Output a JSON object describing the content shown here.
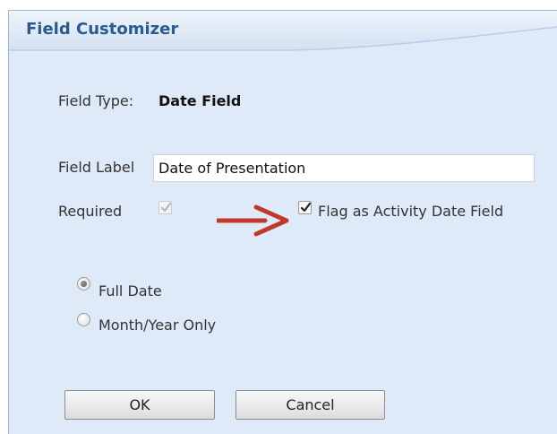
{
  "dialog": {
    "title": "Field Customizer"
  },
  "field_type": {
    "label": "Field Type:",
    "value": "Date Field"
  },
  "field_label": {
    "label": "Field Label",
    "value": "Date of Presentation"
  },
  "required": {
    "label": "Required",
    "checked": true,
    "disabled": true
  },
  "activity_flag": {
    "label": "Flag as Activity Date Field",
    "checked": true
  },
  "date_format": {
    "options": [
      {
        "label": "Full Date",
        "selected": true
      },
      {
        "label": "Month/Year Only",
        "selected": false
      }
    ]
  },
  "buttons": {
    "ok": "OK",
    "cancel": "Cancel"
  },
  "colors": {
    "dialog_bg": "#dfeaf8",
    "title": "#2a5b8f",
    "annotation_arrow": "#c0392b"
  },
  "icons": {
    "annotation": "red-arrow-icon",
    "check": "checkmark-icon"
  }
}
